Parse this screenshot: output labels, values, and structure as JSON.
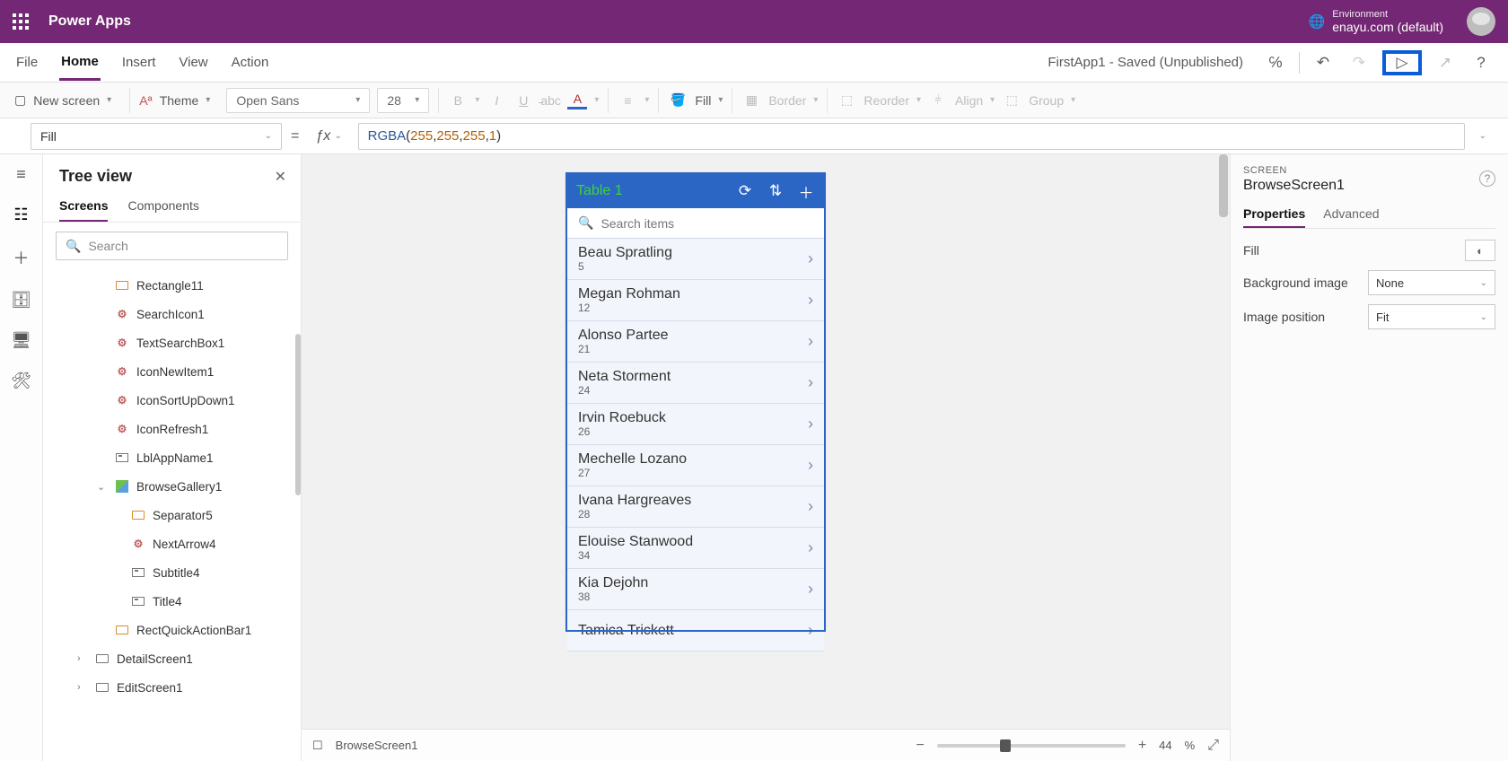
{
  "header": {
    "brand": "Power Apps",
    "env_label": "Environment",
    "env_name": "enayu.com (default)"
  },
  "menubar": {
    "tabs": [
      "File",
      "Home",
      "Insert",
      "View",
      "Action"
    ],
    "active": 1,
    "app_status": "FirstApp1 - Saved (Unpublished)"
  },
  "ribbon": {
    "new_screen": "New screen",
    "theme": "Theme",
    "font": "Open Sans",
    "font_size": "28",
    "fill": "Fill",
    "border": "Border",
    "reorder": "Reorder",
    "align": "Align",
    "group": "Group"
  },
  "formula_bar": {
    "property": "Fill",
    "fn": "RGBA",
    "args": [
      "255",
      "255",
      "255",
      "1"
    ]
  },
  "tree": {
    "title": "Tree view",
    "tabs": [
      "Screens",
      "Components"
    ],
    "search_placeholder": "Search",
    "nodes": [
      {
        "name": "Rectangle11",
        "icon": "rect",
        "depth": 1
      },
      {
        "name": "SearchIcon1",
        "icon": "ctrl",
        "depth": 1
      },
      {
        "name": "TextSearchBox1",
        "icon": "ctrl",
        "depth": 1
      },
      {
        "name": "IconNewItem1",
        "icon": "ctrl",
        "depth": 1
      },
      {
        "name": "IconSortUpDown1",
        "icon": "ctrl",
        "depth": 1
      },
      {
        "name": "IconRefresh1",
        "icon": "ctrl",
        "depth": 1
      },
      {
        "name": "LblAppName1",
        "icon": "lbl",
        "depth": 1
      },
      {
        "name": "BrowseGallery1",
        "icon": "gal",
        "depth": 1,
        "exp": true
      },
      {
        "name": "Separator5",
        "icon": "rect",
        "depth": 2
      },
      {
        "name": "NextArrow4",
        "icon": "ctrl",
        "depth": 2
      },
      {
        "name": "Subtitle4",
        "icon": "lbl",
        "depth": 2
      },
      {
        "name": "Title4",
        "icon": "lbl",
        "depth": 2
      },
      {
        "name": "RectQuickActionBar1",
        "icon": "rect",
        "depth": 1
      },
      {
        "name": "DetailScreen1",
        "icon": "scr",
        "depth": 0,
        "col": true
      },
      {
        "name": "EditScreen1",
        "icon": "scr",
        "depth": 0,
        "col": true
      }
    ]
  },
  "canvas_app": {
    "title": "Table 1",
    "search_placeholder": "Search items",
    "rows": [
      {
        "name": "Beau Spratling",
        "sub": "5"
      },
      {
        "name": "Megan Rohman",
        "sub": "12"
      },
      {
        "name": "Alonso Partee",
        "sub": "21"
      },
      {
        "name": "Neta Storment",
        "sub": "24"
      },
      {
        "name": "Irvin Roebuck",
        "sub": "26"
      },
      {
        "name": "Mechelle Lozano",
        "sub": "27"
      },
      {
        "name": "Ivana Hargreaves",
        "sub": "28"
      },
      {
        "name": "Elouise Stanwood",
        "sub": "34"
      },
      {
        "name": "Kia Dejohn",
        "sub": "38"
      },
      {
        "name": "Tamica Trickett",
        "sub": ""
      }
    ]
  },
  "status": {
    "screen_name": "BrowseScreen1",
    "zoom": "44",
    "zoom_unit": "%"
  },
  "props": {
    "section": "SCREEN",
    "name": "BrowseScreen1",
    "tabs": [
      "Properties",
      "Advanced"
    ],
    "fill_label": "Fill",
    "bg_label": "Background image",
    "bg_value": "None",
    "pos_label": "Image position",
    "pos_value": "Fit"
  }
}
